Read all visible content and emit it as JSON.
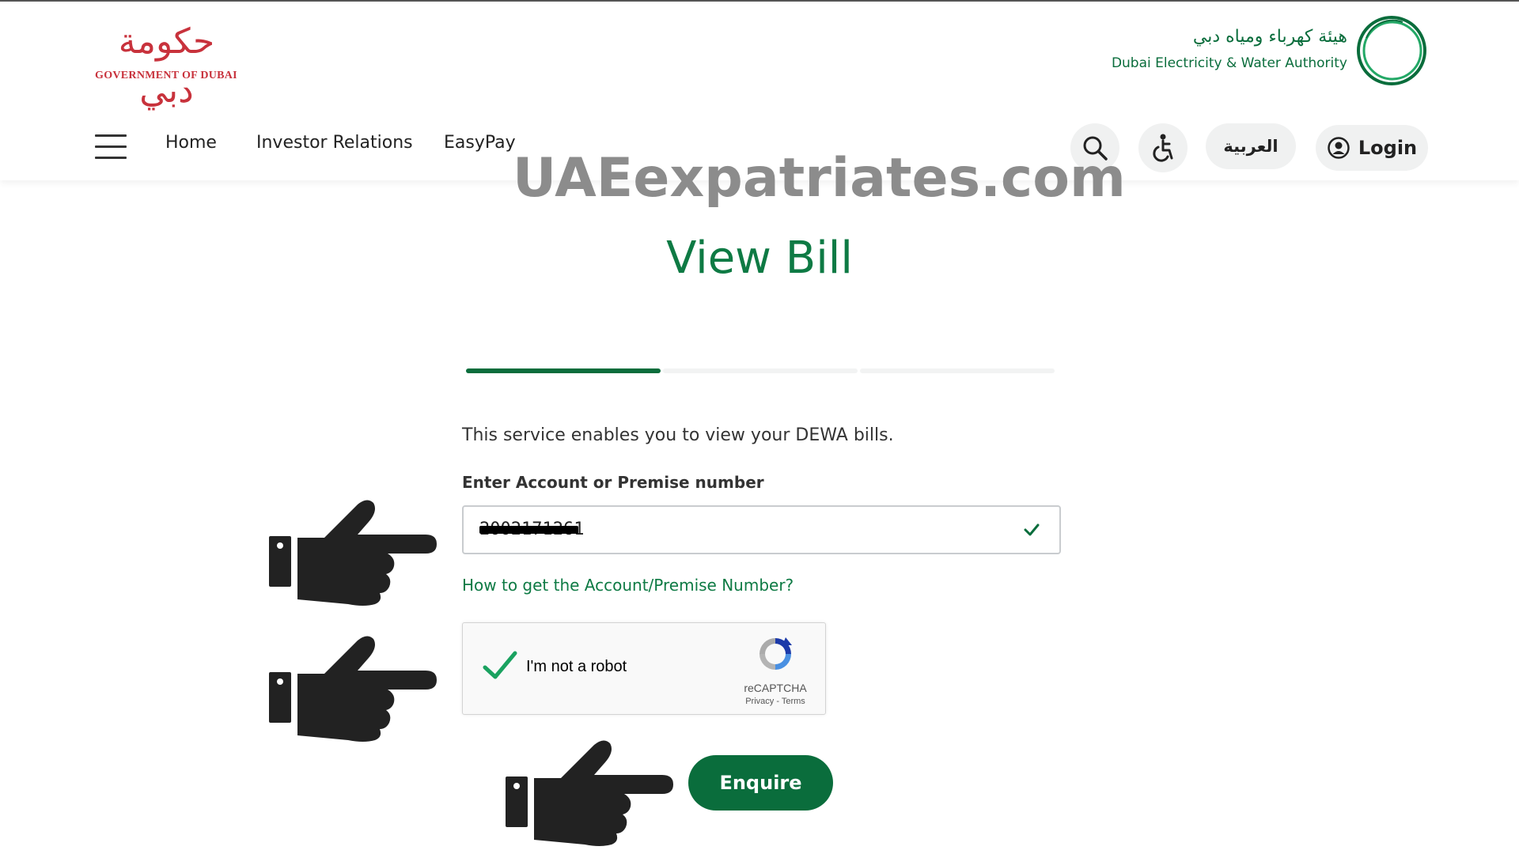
{
  "header": {
    "gov_logo_arabic": "حكومة دبي",
    "gov_logo_english": "GOVERNMENT OF DUBAI",
    "dewa_logo_arabic": "هيئة كهرباء ومياه دبي",
    "dewa_logo_english": "Dubai Electricity & Water Authority",
    "nav": [
      "Home",
      "Investor Relations",
      "EasyPay"
    ],
    "search_icon": "search-icon",
    "accessibility_icon": "accessibility-icon",
    "language_label": "العربية",
    "login_label": "Login",
    "login_icon": "user-circle-icon"
  },
  "watermark": "UAEexpatriates.com",
  "page": {
    "title": "View Bill",
    "steps_total": 3,
    "current_step": 1,
    "intro": "This service enables you to view your DEWA bills.",
    "field_label": "Enter Account or Premise number",
    "field_value": "2002171261",
    "help_link": "How to get the Account/Premise Number?",
    "enquire_label": "Enquire"
  },
  "recaptcha": {
    "label": "I'm not a robot",
    "brand": "reCAPTCHA",
    "links": "Privacy - Terms",
    "checked": true
  },
  "colors": {
    "brand_green": "#0a6d3c",
    "title_green": "#0e7a44",
    "gov_red": "#c8323c",
    "button_bg": "#f0f1f1"
  }
}
